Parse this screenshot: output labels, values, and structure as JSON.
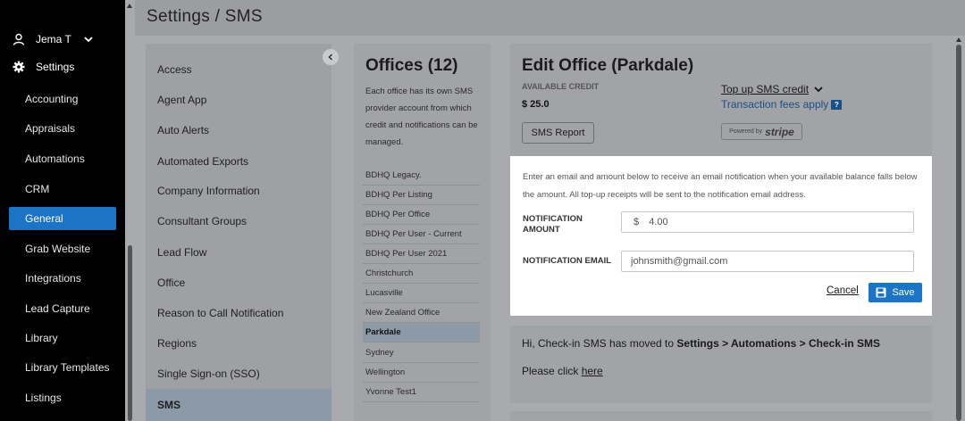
{
  "user": {
    "name": "Jema T"
  },
  "nav": {
    "settings_label": "Settings",
    "items": [
      {
        "label": "Accounting"
      },
      {
        "label": "Appraisals"
      },
      {
        "label": "Automations"
      },
      {
        "label": "CRM"
      },
      {
        "label": "General"
      },
      {
        "label": "Grab Website"
      },
      {
        "label": "Integrations"
      },
      {
        "label": "Lead Capture"
      },
      {
        "label": "Library"
      },
      {
        "label": "Library Templates"
      },
      {
        "label": "Listings"
      }
    ],
    "active": "General"
  },
  "header": {
    "title": "Settings / SMS"
  },
  "settings_menu": {
    "items": [
      {
        "label": "Access"
      },
      {
        "label": "Agent App"
      },
      {
        "label": "Auto Alerts"
      },
      {
        "label": "Automated Exports"
      },
      {
        "label": "Company Information"
      },
      {
        "label": "Consultant Groups"
      },
      {
        "label": "Lead Flow"
      },
      {
        "label": "Office"
      },
      {
        "label": "Reason to Call Notification"
      },
      {
        "label": "Regions"
      },
      {
        "label": "Single Sign-on (SSO)"
      },
      {
        "label": "SMS"
      }
    ],
    "active": "SMS"
  },
  "offices": {
    "title": "Offices (12)",
    "description": "Each office has its own SMS provider account from which credit and notifications can be managed.",
    "items": [
      {
        "label": "BDHQ Legacy."
      },
      {
        "label": "BDHQ Per Listing"
      },
      {
        "label": "BDHQ Per Office"
      },
      {
        "label": "BDHQ Per User - Current"
      },
      {
        "label": "BDHQ Per User 2021"
      },
      {
        "label": "Christchurch"
      },
      {
        "label": "Lucasville"
      },
      {
        "label": "New Zealand Office"
      },
      {
        "label": "Parkdale"
      },
      {
        "label": "Sydney"
      },
      {
        "label": "Wellington"
      },
      {
        "label": "Yvonne Test1"
      }
    ],
    "selected": "Parkdale"
  },
  "edit_office": {
    "title": "Edit Office (Parkdale)",
    "available_credit_label": "AVAILABLE CREDIT",
    "available_credit_value": "$ 25.0",
    "top_up_label": "Top up SMS credit",
    "fees_label": "Transaction fees apply",
    "fees_badge": "?",
    "sms_report_label": "SMS Report",
    "stripe_prefix": "Powered by",
    "stripe_word": "stripe"
  },
  "notification": {
    "info_text": "Enter an email and amount below to receive an email notification when your available balance falls below the amount. All top-up receipts will be sent to the notification email address.",
    "amount_label": "NOTIFICATION AMOUNT",
    "amount_currency": "$",
    "amount_value": "4.00",
    "email_label": "NOTIFICATION EMAIL",
    "email_value": "johnsmith@gmail.com",
    "cancel_label": "Cancel",
    "save_label": "Save"
  },
  "checkin": {
    "text_prefix": "Hi, Check-in SMS has moved to ",
    "text_path": "Settings > Automations > Check-in SMS",
    "click_prefix": "Please click ",
    "click_link": "here"
  },
  "colors": {
    "accent": "#1b74c5",
    "selected_row": "#8c9aa8",
    "sidebar_bg": "#000000"
  }
}
